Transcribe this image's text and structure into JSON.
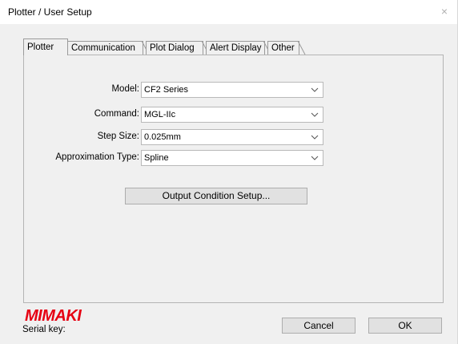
{
  "window": {
    "title": "Plotter / User Setup",
    "close_glyph": "×"
  },
  "tabs": [
    {
      "label": "Plotter",
      "active": true
    },
    {
      "label": "Communication",
      "active": false
    },
    {
      "label": "Plot Dialog",
      "active": false
    },
    {
      "label": "Alert Display",
      "active": false
    },
    {
      "label": "Other",
      "active": false
    }
  ],
  "fields": {
    "model": {
      "label": "Model:",
      "value": "CF2 Series"
    },
    "command": {
      "label": "Command:",
      "value": "MGL-IIc"
    },
    "step_size": {
      "label": "Step Size:",
      "value": "0.025mm"
    },
    "approximation_type": {
      "label": "Approximation Type:",
      "value": "Spline"
    }
  },
  "buttons": {
    "output_condition": "Output Condition Setup...",
    "cancel": "Cancel",
    "ok": "OK"
  },
  "footer": {
    "logo_text": "Mimaki",
    "serial_label": "Serial key:"
  },
  "colors": {
    "logo_red": "#e60012",
    "window_bg": "#f0f0f0",
    "titlebar_bg": "#ffffff"
  },
  "icons": {
    "dropdown": "chevron-down-icon",
    "close": "close-icon"
  }
}
